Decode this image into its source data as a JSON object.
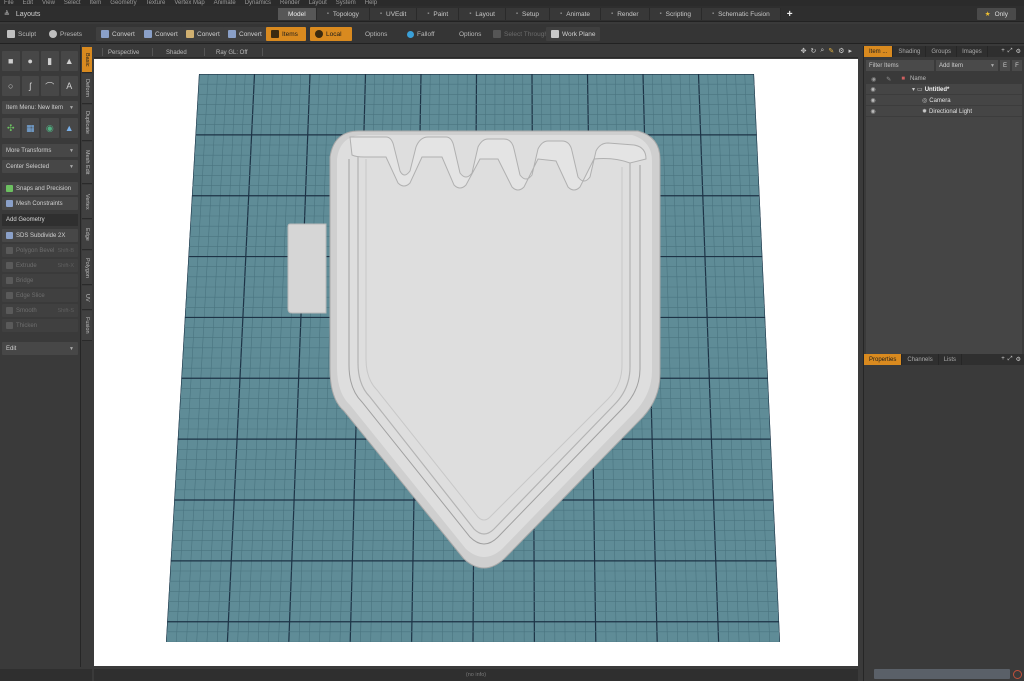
{
  "menubar": [
    "File",
    "Edit",
    "View",
    "Select",
    "Item",
    "Geometry",
    "Texture",
    "Vertex Map",
    "Animate",
    "Dynamics",
    "Render",
    "Layout",
    "System",
    "Help"
  ],
  "layouts": {
    "label": "Layouts"
  },
  "tabs": [
    {
      "label": "Model",
      "active": true
    },
    {
      "label": "Topology"
    },
    {
      "label": "UVEdit"
    },
    {
      "label": "Paint"
    },
    {
      "label": "Layout"
    },
    {
      "label": "Setup"
    },
    {
      "label": "Animate"
    },
    {
      "label": "Render"
    },
    {
      "label": "Scripting"
    },
    {
      "label": "Schematic Fusion"
    }
  ],
  "tab_add": "+",
  "only": {
    "label": "Only"
  },
  "toolheader": {
    "sculpt": "Sculpt",
    "presets": "Presets",
    "convert1": "Convert",
    "convert2": "Convert",
    "convert3": "Convert",
    "convert4": "Convert",
    "items": "Items",
    "local": "Local",
    "options1": "Options",
    "falloff": "Falloff",
    "options2": "Options",
    "select_through": "Select Through",
    "work_plane": "Work Plane"
  },
  "toolbox": {
    "item_menu": "Item Menu: New Item",
    "more_transforms": "More Transforms",
    "center_selected": "Center Selected",
    "snaps": "Snaps and Precision",
    "mesh_constraints": "Mesh Constraints",
    "add_geometry": "Add Geometry",
    "sds_subdivide": "SDS Subdivide 2X",
    "polygon_bevel": "Polygon Bevel",
    "polygon_bevel_sc": "Shift-B",
    "extrude": "Extrude",
    "extrude_sc": "Shift-X",
    "bridge": "Bridge",
    "edge_slice": "Edge Slice",
    "smooth": "Smooth",
    "smooth_sc": "Shift-S",
    "thicken": "Thicken",
    "edit": "Edit"
  },
  "vtabs": [
    "Basic",
    "Deform",
    "Duplicate",
    "Mesh Edit",
    "Vertex",
    "Edge",
    "Polygon",
    "UV",
    "Fusion"
  ],
  "viewport": {
    "perspective": "Perspective",
    "shaded": "Shaded",
    "ray_gl": "Ray GL: Off",
    "grid_color": "#5f8c97",
    "minor_line": "#4a7480",
    "major_line": "#1d3346",
    "model_color": "#dcdcdc"
  },
  "status": "(no info)",
  "rpanel": {
    "tabs": [
      "Item ...",
      "Shading",
      "Groups",
      "Images"
    ],
    "filter": "Filter Items",
    "add_item": "Add Item",
    "name_col": "Name",
    "tree": [
      {
        "label": "Untitled*",
        "bold": true
      },
      {
        "label": "Camera"
      },
      {
        "label": "Directional Light"
      }
    ],
    "props_tabs": [
      "Properties",
      "Channels",
      "Lists"
    ]
  },
  "colors": {
    "accent": "#d98a1f",
    "bg": "#3a3a3a"
  }
}
